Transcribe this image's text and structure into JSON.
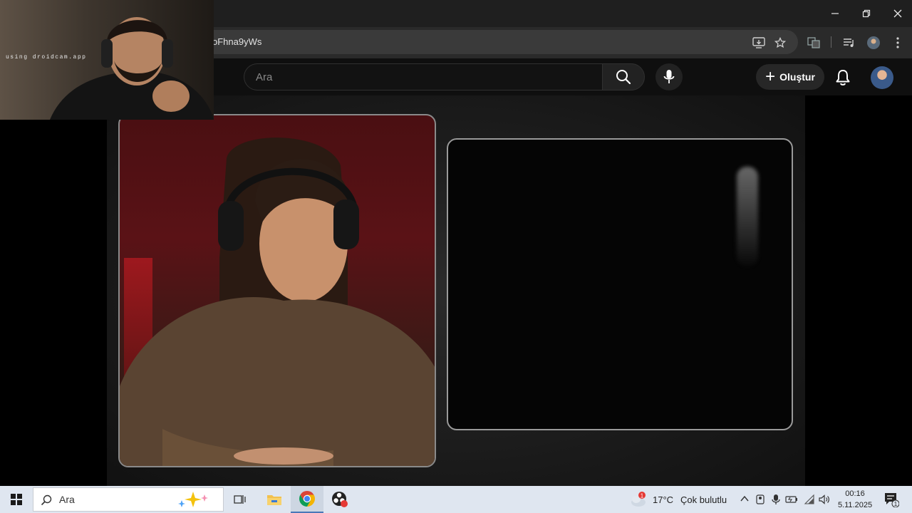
{
  "browser": {
    "url_fragment": "oFhna9yWs",
    "window_controls": [
      "minimize",
      "restore",
      "close"
    ]
  },
  "youtube": {
    "search_placeholder": "Ara",
    "create_label": "Oluştur"
  },
  "webcam_overlay": {
    "watermark": "using droidcam.app"
  },
  "taskbar": {
    "search_label": "Ara",
    "weather_temp": "17°C",
    "weather_desc": "Çok bulutlu",
    "weather_badge": "1",
    "time": "00:16",
    "date": "5.11.2025",
    "notification_count": "1",
    "apps": [
      "task-view",
      "file-explorer",
      "chrome",
      "obs"
    ]
  },
  "colors": {
    "chrome_dark": "#1f1f1f",
    "youtube_bg": "#0f0f0f",
    "taskbar_bg": "#dfe6f0",
    "chrome_red": "#db4437",
    "chrome_yellow": "#f4b400",
    "chrome_green": "#0f9d58",
    "chrome_blue": "#4285f4"
  }
}
